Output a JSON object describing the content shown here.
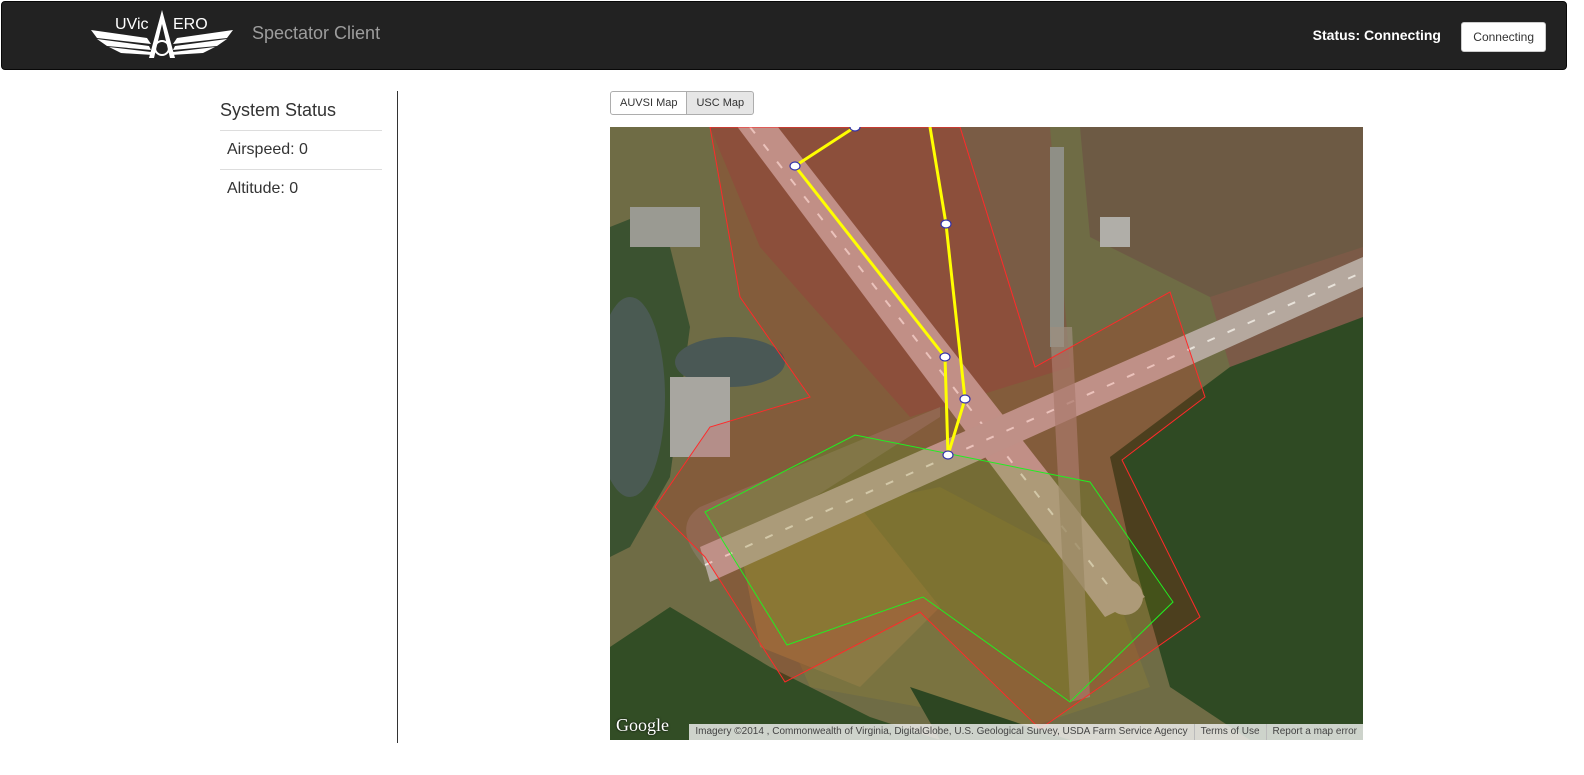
{
  "navbar": {
    "brand_name": "Spectator Client",
    "logo_text": "UVicAERO",
    "status_text": "Status: Connecting",
    "connect_button_label": "Connecting"
  },
  "sidebar": {
    "title": "System Status",
    "items": [
      {
        "label": "Airspeed: 0"
      },
      {
        "label": "Altitude: 0"
      }
    ]
  },
  "map_tabs": [
    {
      "label": "AUVSI Map",
      "active": true
    },
    {
      "label": "USC Map",
      "active": false
    }
  ],
  "map": {
    "provider_logo": "Google",
    "attribution": "Imagery ©2014 , Commonwealth of Virginia, DigitalGlobe, U.S. Geological Survey, USDA Farm Service Agency",
    "terms_link": "Terms of Use",
    "report_link": "Report a map error",
    "colors": {
      "flight_path": "#ffff00",
      "boundary": "#ff2a2a",
      "search_area": "#22ee22",
      "waypoint_fill": "#ffffff",
      "waypoint_stroke": "#3333aa"
    }
  }
}
